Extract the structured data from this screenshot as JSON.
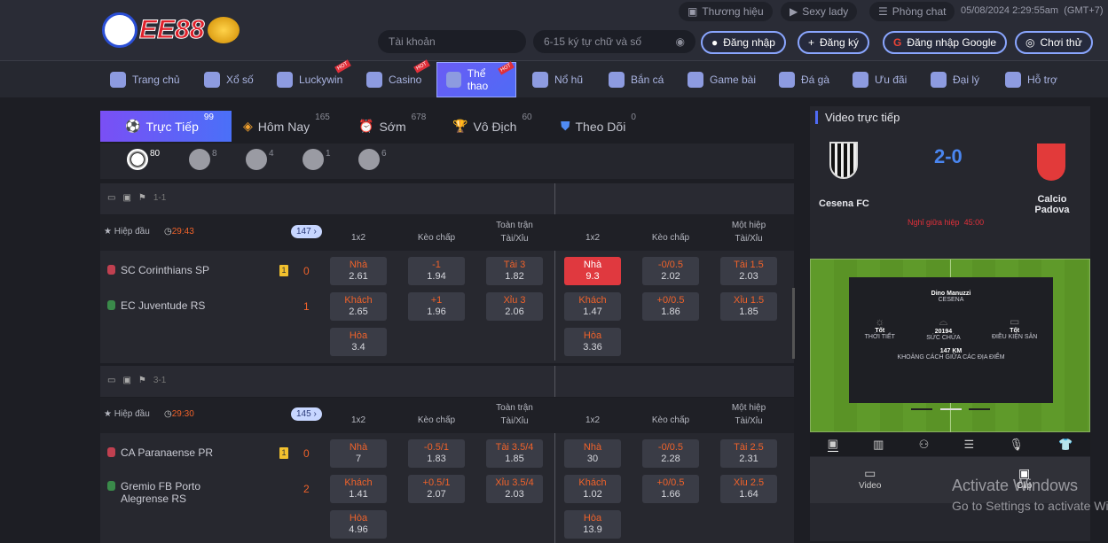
{
  "header": {
    "logo_text": "EE88",
    "links": [
      {
        "label": "Thương hiệu",
        "icon": "brand-icon"
      },
      {
        "label": "Sexy lady",
        "icon": "play-icon"
      },
      {
        "label": "Phòng chat",
        "icon": "chat-icon"
      }
    ],
    "datetime": "05/08/2024 2:29:55am",
    "timezone": "(GMT+7)",
    "account_placeholder": "Tài khoản",
    "password_placeholder": "6-15 ký tự chữ và số",
    "login": "Đăng nhập",
    "register": "Đăng ký",
    "google_login": "Đăng nhập Google",
    "trial": "Chơi thử"
  },
  "nav": {
    "items": [
      {
        "label": "Trang chủ"
      },
      {
        "label": "Xổ số"
      },
      {
        "label": "Luckywin",
        "hot": "HOT"
      },
      {
        "label": "Casino",
        "hot": "HOT"
      },
      {
        "label": "Thể thao",
        "hot": "HOT",
        "active": true
      },
      {
        "label": "Nổ hũ"
      },
      {
        "label": "Bắn cá"
      },
      {
        "label": "Game bài"
      },
      {
        "label": "Đá gà"
      },
      {
        "label": "Ưu đãi"
      },
      {
        "label": "Đại lý"
      },
      {
        "label": "Hỗ trợ"
      }
    ]
  },
  "tabs": [
    {
      "label": "Trực Tiếp",
      "count": "99",
      "active": true
    },
    {
      "label": "Hôm Nay",
      "count": "165"
    },
    {
      "label": "Sớm",
      "count": "678"
    },
    {
      "label": "Vô Địch",
      "count": "60"
    },
    {
      "label": "Theo Dõi",
      "count": "0"
    }
  ],
  "sports": [
    {
      "icon": "soccer-icon",
      "count": "80"
    },
    {
      "icon": "basketball-icon",
      "count": "8"
    },
    {
      "icon": "tennis-icon",
      "count": "4"
    },
    {
      "icon": "volleyball-icon",
      "count": "1"
    },
    {
      "icon": "table-tennis-icon",
      "count": "6"
    }
  ],
  "columns": {
    "c1": "1x2",
    "c2": "Kèo chấp",
    "c3a": "Toàn trận",
    "c3b": "Tài/Xỉu",
    "c4": "1x2",
    "c5": "Kèo chấp",
    "c6a": "Một hiệp",
    "c6b": "Tài/Xỉu"
  },
  "matches": [
    {
      "corner": "1-1",
      "period": "Hiệp đầu",
      "time": "29:43",
      "markets": "147 ›",
      "home": "SC Corinthians SP",
      "away": "EC Juventude RS",
      "home_card": "1",
      "home_score": "0",
      "away_score": "1",
      "odds": [
        [
          [
            "Nhà",
            "2.61"
          ],
          [
            "-1",
            "1.94"
          ],
          [
            "Tài 3",
            "1.82"
          ],
          [
            "Nhà",
            "9.3",
            "hl"
          ],
          [
            "-0/0.5",
            "2.02"
          ],
          [
            "Tài 1.5",
            "2.03"
          ]
        ],
        [
          [
            "Khách",
            "2.65"
          ],
          [
            "+1",
            "1.96"
          ],
          [
            "Xỉu 3",
            "2.06"
          ],
          [
            "Khách",
            "1.47"
          ],
          [
            "+0/0.5",
            "1.86"
          ],
          [
            "Xỉu 1.5",
            "1.85"
          ]
        ],
        [
          [
            "Hòa",
            "3.4"
          ],
          null,
          null,
          [
            "Hòa",
            "3.36"
          ],
          null,
          null
        ]
      ]
    },
    {
      "corner": "3-1",
      "period": "Hiệp đầu",
      "time": "29:30",
      "markets": "145 ›",
      "home": "CA Paranaense PR",
      "away": "Gremio FB Porto Alegrense RS",
      "home_card": "1",
      "home_score": "0",
      "away_score": "2",
      "odds": [
        [
          [
            "Nhà",
            "7"
          ],
          [
            "-0.5/1",
            "1.83"
          ],
          [
            "Tài 3.5/4",
            "1.85"
          ],
          [
            "Nhà",
            "30"
          ],
          [
            "-0/0.5",
            "2.28"
          ],
          [
            "Tài 2.5",
            "2.31"
          ]
        ],
        [
          [
            "Khách",
            "1.41"
          ],
          [
            "+0.5/1",
            "2.07"
          ],
          [
            "Xỉu 3.5/4",
            "2.03"
          ],
          [
            "Khách",
            "1.02"
          ],
          [
            "+0/0.5",
            "1.66"
          ],
          [
            "Xỉu 2.5",
            "1.64"
          ]
        ],
        [
          [
            "Hòa",
            "4.96"
          ],
          null,
          null,
          [
            "Hòa",
            "13.9"
          ],
          null,
          null
        ]
      ]
    }
  ],
  "video": {
    "title": "Video trực tiếp",
    "home": "Cesena FC",
    "away": "Calcio Padova",
    "score": "2-0",
    "status": "Nghỉ giữa hiệp",
    "status_time": "45:00",
    "stadium": "Dino Manuzzi",
    "city": "CESENA",
    "weather_value": "Tốt",
    "weather_label": "THỜI TIẾT",
    "capacity_value": "20194",
    "capacity_label": "SỨC CHỨA",
    "pitch_value": "Tốt",
    "pitch_label": "ĐIỀU KIỆN SÂN",
    "distance": "147 KM",
    "distance_label": "KHOẢNG CÁCH GIỮA CÁC ĐỊA ĐIỂM",
    "bottom": [
      {
        "label": "Video"
      },
      {
        "label": "Clip"
      }
    ]
  },
  "watermark": {
    "line1": "Activate Windows",
    "line2": "Go to Settings to activate Windows."
  },
  "colors": {
    "accent": "#4f6bf5",
    "odds_label": "#f0622a",
    "highlight": "#e0393f",
    "score": "#4a86f0"
  }
}
